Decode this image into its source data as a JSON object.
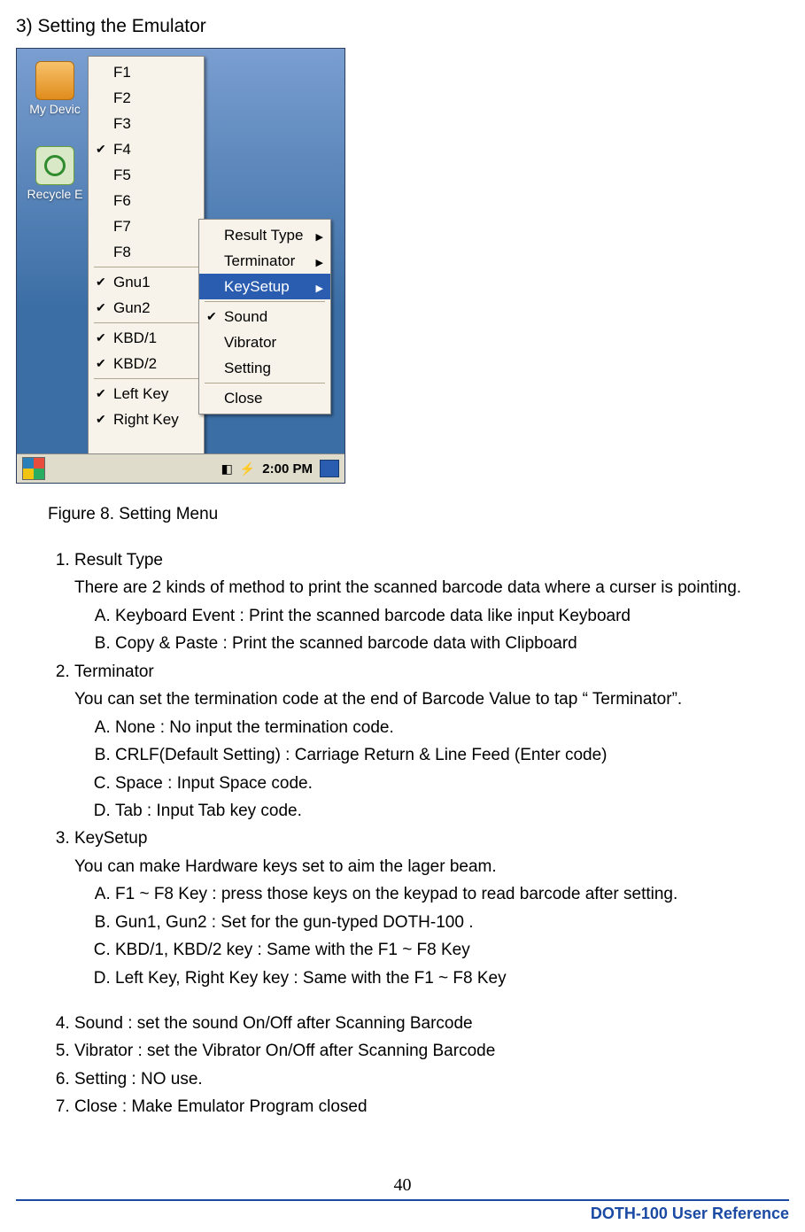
{
  "heading": "3) Setting the Emulator",
  "desktop": {
    "my_device": "My Devic",
    "recycle": "Recycle E"
  },
  "menu1": {
    "f1": "F1",
    "f2": "F2",
    "f3": "F3",
    "f4": "F4",
    "f5": "F5",
    "f6": "F6",
    "f7": "F7",
    "f8": "F8",
    "gnu1": "Gnu1",
    "gun2": "Gun2",
    "kbd1": "KBD/1",
    "kbd2": "KBD/2",
    "leftkey": "Left Key",
    "rightkey": "Right Key"
  },
  "menu2": {
    "result_type": "Result Type",
    "terminator": "Terminator",
    "keysetup": "KeySetup",
    "sound": "Sound",
    "vibrator": "Vibrator",
    "setting": "Setting",
    "close": "Close"
  },
  "taskbar": {
    "time": "2:00 PM"
  },
  "caption": "Figure 8. Setting Menu",
  "list": {
    "i1": {
      "title": "Result Type",
      "desc": "There are 2 kinds of method to print the scanned barcode data where a curser is pointing.",
      "a": "Keyboard Event : Print the scanned barcode data like input Keyboard",
      "b": "Copy & Paste : Print the scanned barcode data with Clipboard"
    },
    "i2": {
      "title": "Terminator",
      "desc": "You can set the termination code at the end of Barcode Value to tap “ Terminator”.",
      "a": "None : No input the termination code.",
      "b": "CRLF(Default Setting) : Carriage Return & Line Feed (Enter code)",
      "c": "Space : Input Space code.",
      "d": "Tab : Input Tab key code."
    },
    "i3": {
      "title": "KeySetup",
      "desc": "You can make Hardware keys set to aim the lager beam.",
      "a": "F1 ~ F8 Key : press those keys on the keypad to read barcode after setting.",
      "b": "Gun1, Gun2 : Set for the gun-typed DOTH-100 .",
      "c": "KBD/1, KBD/2 key : Same with the F1 ~ F8 Key",
      "d": "Left Key, Right Key key : Same with the F1 ~ F8 Key"
    },
    "i4": "Sound : set the sound On/Off after Scanning Barcode",
    "i5": "Vibrator : set the Vibrator On/Off after Scanning Barcode",
    "i6": "Setting : NO use.",
    "i7": "Close : Make Emulator Program closed"
  },
  "page_number": "40",
  "footer": "DOTH-100 User Reference"
}
